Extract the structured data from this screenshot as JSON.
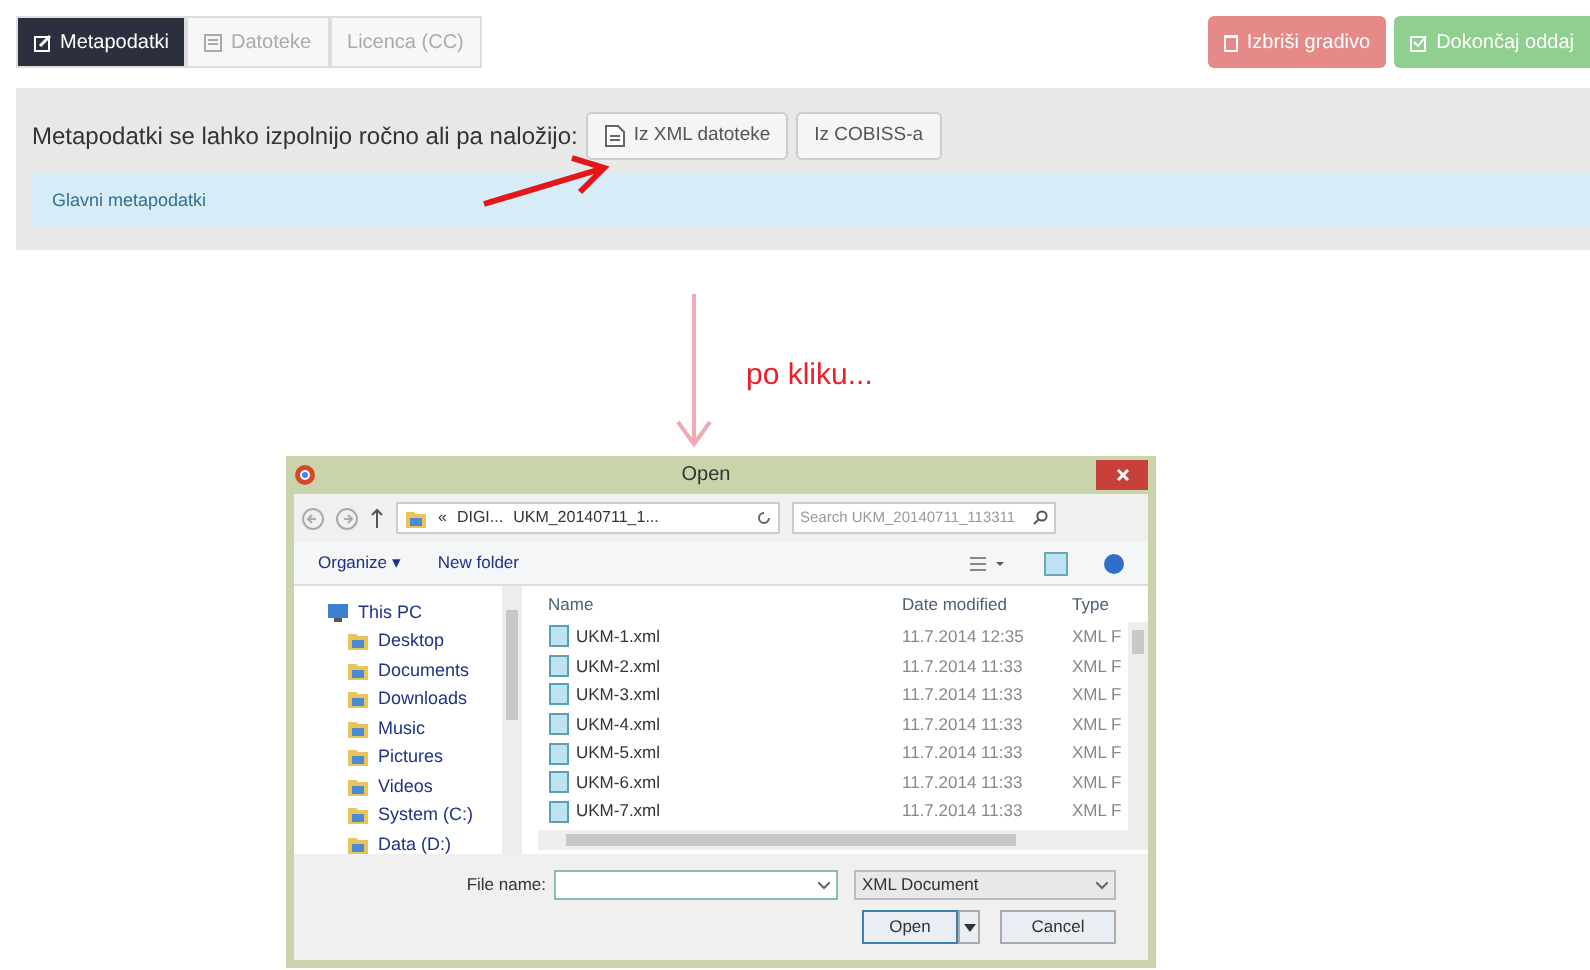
{
  "tabs": [
    {
      "label": "Metapodatki",
      "selected": true
    },
    {
      "label": "Datoteke",
      "selected": false
    },
    {
      "label": "Licenca (CC)",
      "selected": false
    }
  ],
  "actions": [
    {
      "label": "Izbriši gradivo",
      "kind": "danger"
    },
    {
      "label": "Dokončaj oddaj",
      "kind": "success"
    }
  ],
  "panel": {
    "prompt": "Metapodatki se lahko izpolnijo ročno ali pa naložijo:",
    "buttons": [
      {
        "label": "Iz XML datoteke",
        "kind": "file"
      },
      {
        "label": "Iz COBISS-a",
        "kind": "plain"
      }
    ],
    "section": "Glavni metapodatki"
  },
  "caption": "po kliku...",
  "dialog": {
    "title": "Open",
    "path": [
      "«",
      "DIGI...",
      "UKM_20140711_1..."
    ],
    "search": {
      "placeholder": "Search UKM_20140711_113311"
    },
    "toolbar": [
      "Organize ▾",
      "New folder"
    ],
    "sidebar": [
      {
        "label": "This PC",
        "children": [
          {
            "label": "Desktop"
          },
          {
            "label": "Documents"
          },
          {
            "label": "Downloads"
          },
          {
            "label": "Music"
          },
          {
            "label": "Pictures"
          },
          {
            "label": "Videos"
          },
          {
            "label": "System (C:)"
          },
          {
            "label": "Data (D:)"
          }
        ]
      }
    ],
    "columns": [
      "Name",
      "Date modified",
      "Type"
    ],
    "rows": [
      {
        "name": "UKM-1.xml",
        "date": "11.7.2014 12:35",
        "type": "XML F"
      },
      {
        "name": "UKM-2.xml",
        "date": "11.7.2014 11:33",
        "type": "XML F"
      },
      {
        "name": "UKM-3.xml",
        "date": "11.7.2014 11:33",
        "type": "XML F"
      },
      {
        "name": "UKM-4.xml",
        "date": "11.7.2014 11:33",
        "type": "XML F"
      },
      {
        "name": "UKM-5.xml",
        "date": "11.7.2014 11:33",
        "type": "XML F"
      },
      {
        "name": "UKM-6.xml",
        "date": "11.7.2014 11:33",
        "type": "XML F"
      },
      {
        "name": "UKM-7.xml",
        "date": "11.7.2014 11:33",
        "type": "XML F"
      }
    ],
    "file_name_label": "File name:",
    "file_type": "XML Document",
    "buttons": [
      "Open",
      "Cancel"
    ]
  }
}
